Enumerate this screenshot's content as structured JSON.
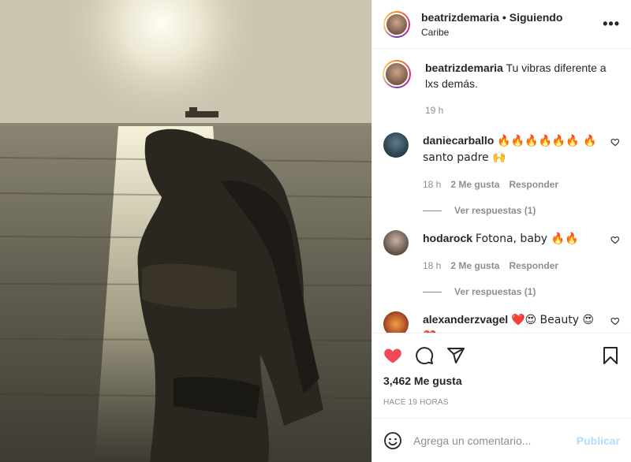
{
  "post": {
    "username": "beatrizdemaria",
    "separator": "•",
    "follow_state": "Siguiendo",
    "location": "Caribe",
    "more_icon": "more-horizontal-icon",
    "more_label": "•••"
  },
  "caption": {
    "username": "beatrizdemaria",
    "text": "Tu vibras diferente a lxs demás.",
    "time": "19 h"
  },
  "comments": [
    {
      "username": "daniecarballo",
      "text": "🔥🔥🔥🔥🔥🔥 🔥 santo padre 🙌",
      "time": "18 h",
      "likes": "2 Me gusta",
      "reply": "Responder",
      "view_replies": "Ver respuestas (1)"
    },
    {
      "username": "hodarock",
      "text": "Fotona, baby 🔥🔥",
      "time": "18 h",
      "likes": "2 Me gusta",
      "reply": "Responder",
      "view_replies": "Ver respuestas (1)"
    },
    {
      "username": "alexanderzvagel",
      "text": "❤️😍 Beauty 😍❤️"
    }
  ],
  "actions": {
    "like_icon": "heart-filled-icon",
    "comment_icon": "comment-icon",
    "share_icon": "share-icon",
    "save_icon": "bookmark-icon",
    "like_color": "#ed4956",
    "likes": "3,462 Me gusta",
    "posted": "HACE 19 HORAS"
  },
  "composer": {
    "placeholder": "Agrega un comentario...",
    "publish": "Publicar",
    "emoji_icon": "smiley-icon"
  }
}
